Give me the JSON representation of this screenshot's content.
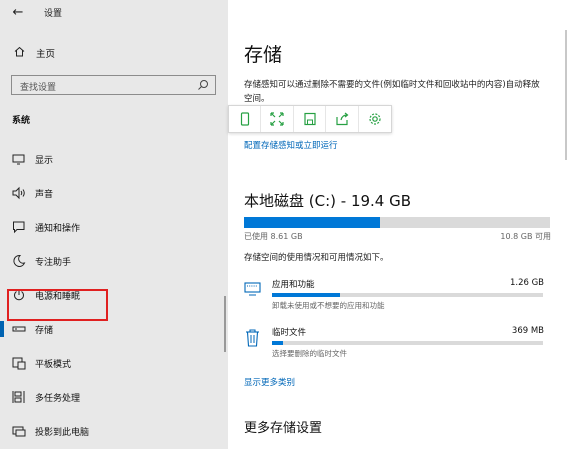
{
  "titlebar": {
    "back_icon": "back-arrow-icon",
    "title": "设置",
    "minimize": "—",
    "close": "✕"
  },
  "sidebar": {
    "home_label": "主页",
    "search_placeholder": "查找设置",
    "group_label": "系统",
    "items": [
      {
        "label": "显示",
        "icon": "monitor-icon"
      },
      {
        "label": "声音",
        "icon": "speaker-icon"
      },
      {
        "label": "通知和操作",
        "icon": "notification-icon"
      },
      {
        "label": "专注助手",
        "icon": "moon-icon"
      },
      {
        "label": "电源和睡眠",
        "icon": "power-icon"
      },
      {
        "label": "存储",
        "icon": "storage-icon"
      },
      {
        "label": "平板模式",
        "icon": "tablet-icon"
      },
      {
        "label": "多任务处理",
        "icon": "multitask-icon"
      },
      {
        "label": "投影到此电脑",
        "icon": "project-icon"
      }
    ],
    "active_item": "存储"
  },
  "main": {
    "title": "存储",
    "description": "存储感知可以通过删除不需要的文件(例如临时文件和回收站中的内容)自动释放空间。",
    "config_link": "配置存储感知或立即运行",
    "disk_title": "本地磁盘 (C:) - 19.4 GB",
    "disk_used_fraction": 0.444,
    "used_label": "已使用 8.61 GB",
    "free_label": "10.8 GB 可用",
    "usage_desc": "存储空间的使用情况和可用情况如下。",
    "categories": [
      {
        "name": "应用和功能",
        "size": "1.26 GB",
        "sub": "卸载未使用或不想要的应用和功能",
        "fraction": 0.25,
        "icon": "apps-icon"
      },
      {
        "name": "临时文件",
        "size": "369 MB",
        "sub": "选择要删除的临时文件",
        "fraction": 0.04,
        "icon": "trash-icon"
      }
    ],
    "more_link": "显示更多类别",
    "more_title": "更多存储设置"
  },
  "colors": {
    "accent": "#0078d7",
    "link": "#0067b8",
    "sidebar_bg": "#e8e8e8",
    "annotation": "#e02020"
  }
}
